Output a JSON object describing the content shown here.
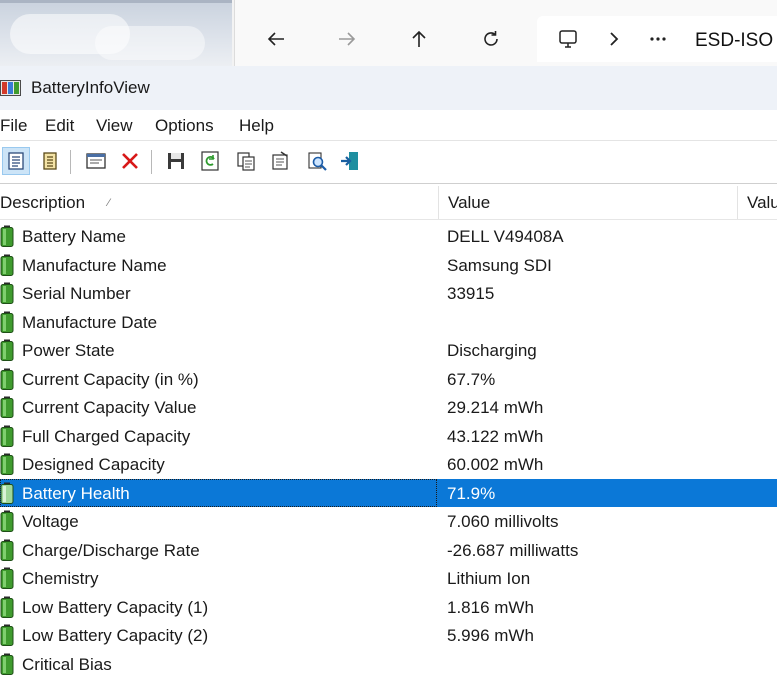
{
  "explorer": {
    "breadcrumb_text": "ESD-ISO"
  },
  "window": {
    "title": "BatteryInfoView"
  },
  "menu": {
    "items": [
      "File",
      "Edit",
      "View",
      "Options",
      "Help"
    ]
  },
  "columns": {
    "description": "Description",
    "value": "Value",
    "value_extra": "Valu"
  },
  "selected_index": 9,
  "rows": [
    {
      "description": "Battery Name",
      "value": "DELL V49408A"
    },
    {
      "description": "Manufacture Name",
      "value": "Samsung SDI"
    },
    {
      "description": "Serial Number",
      "value": "33915"
    },
    {
      "description": "Manufacture Date",
      "value": ""
    },
    {
      "description": "Power State",
      "value": "Discharging"
    },
    {
      "description": "Current Capacity (in %)",
      "value": "67.7%"
    },
    {
      "description": "Current Capacity Value",
      "value": "29.214 mWh"
    },
    {
      "description": "Full Charged Capacity",
      "value": "43.122 mWh"
    },
    {
      "description": "Designed Capacity",
      "value": "60.002 mWh"
    },
    {
      "description": "Battery Health",
      "value": "71.9%"
    },
    {
      "description": "Voltage",
      "value": "7.060 millivolts"
    },
    {
      "description": "Charge/Discharge Rate",
      "value": "-26.687 milliwatts"
    },
    {
      "description": "Chemistry",
      "value": "Lithium Ion"
    },
    {
      "description": "Low Battery Capacity (1)",
      "value": "1.816 mWh"
    },
    {
      "description": "Low Battery Capacity (2)",
      "value": "5.996 mWh"
    },
    {
      "description": "Critical Bias",
      "value": ""
    }
  ],
  "colors": {
    "selection": "#0b78d7",
    "battery_green": "#3f9b2e"
  }
}
